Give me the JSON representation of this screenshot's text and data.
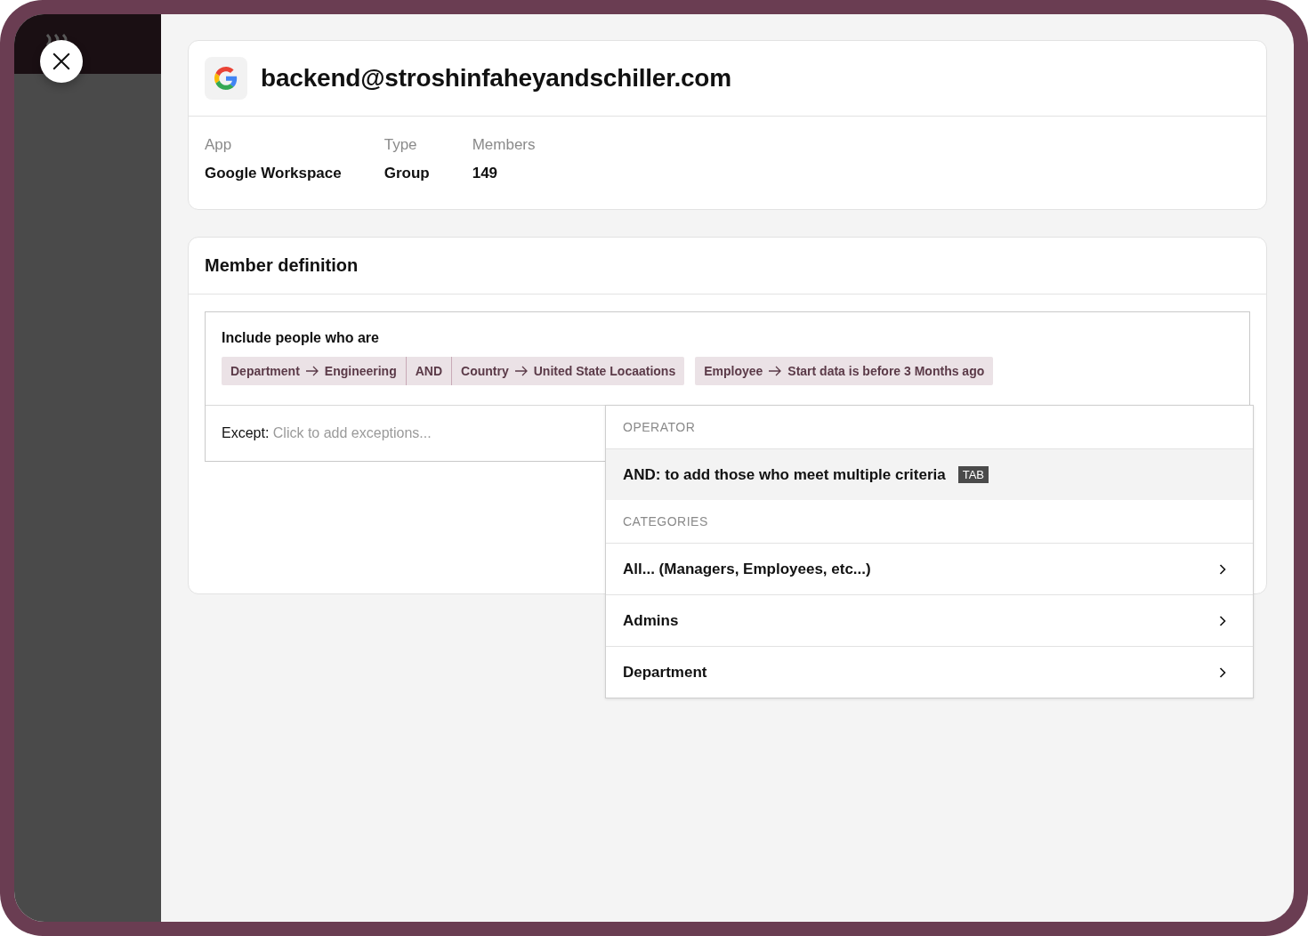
{
  "account": {
    "email": "backend@stroshinfaheyandschiller.com"
  },
  "details": [
    {
      "label": "App",
      "value": "Google Workspace"
    },
    {
      "label": "Type",
      "value": "Group"
    },
    {
      "label": "Members",
      "value": "149"
    }
  ],
  "member_definition": {
    "title": "Member definition",
    "include_label": "Include people who are",
    "criteria_groups": [
      {
        "parts": [
          {
            "kind": "rule",
            "field": "Department",
            "value": "Engineering"
          },
          {
            "kind": "operator",
            "label": "AND"
          },
          {
            "kind": "rule",
            "field": "Country",
            "value": "United State Locaations"
          }
        ]
      },
      {
        "parts": [
          {
            "kind": "rule",
            "field": "Employee",
            "value": "Start data is before 3 Months ago"
          }
        ]
      }
    ],
    "except_label": "Except:",
    "except_placeholder": "Click to add exceptions..."
  },
  "dropdown": {
    "items": [
      {
        "kind": "header",
        "label": "OPERATOR"
      },
      {
        "kind": "operator",
        "label": "AND: to add those who meet multiple criteria",
        "shortcut": "TAB",
        "selected": true
      },
      {
        "kind": "header",
        "label": "CATEGORIES"
      },
      {
        "kind": "category",
        "label": "All... (Managers, Employees, etc...)",
        "selected": false
      },
      {
        "kind": "category",
        "label": "Admins",
        "selected": false
      },
      {
        "kind": "category",
        "label": "Department",
        "selected": false
      }
    ]
  }
}
